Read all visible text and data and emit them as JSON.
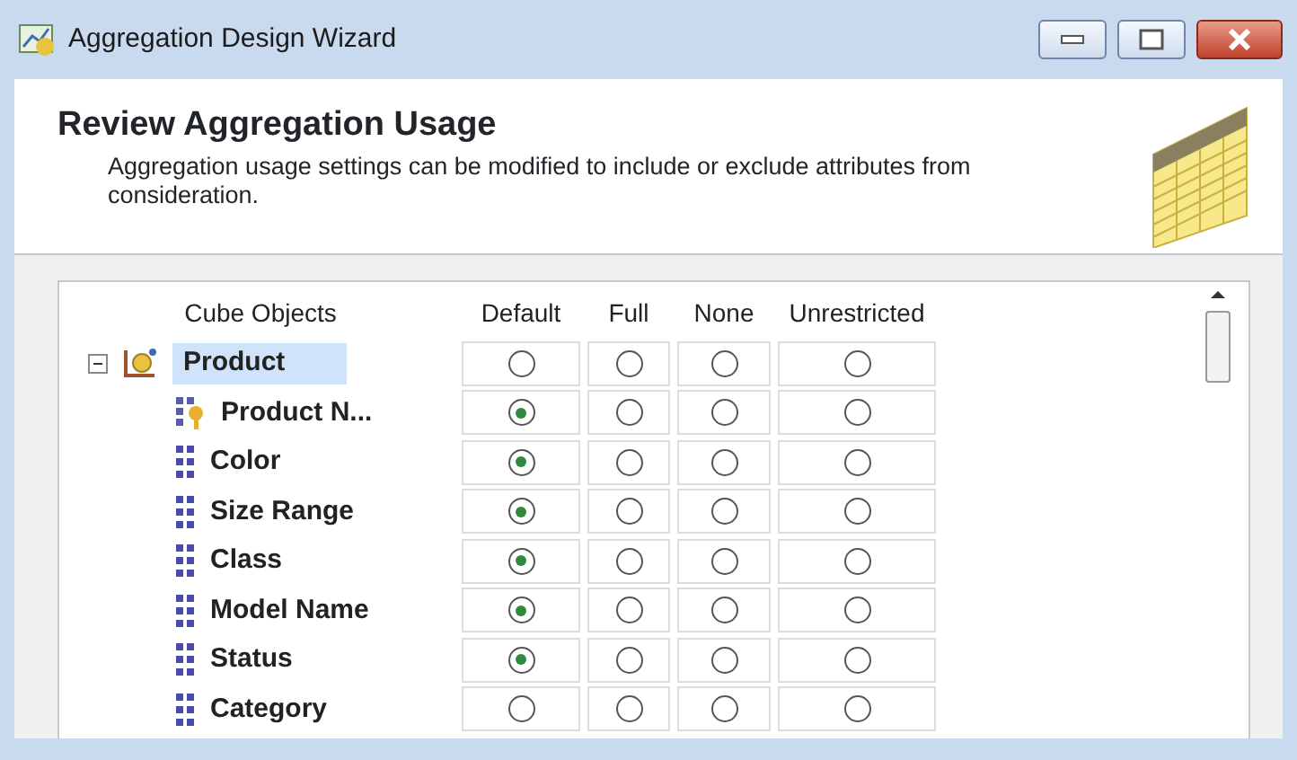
{
  "window": {
    "title": "Aggregation Design Wizard"
  },
  "header": {
    "title": "Review Aggregation Usage",
    "description": "Aggregation usage settings can be modified to include or exclude attributes from consideration."
  },
  "grid": {
    "columns": [
      "Cube Objects",
      "Default",
      "Full",
      "None",
      "Unrestricted"
    ],
    "dimension": {
      "name": "Product",
      "expanded": true,
      "selected": true,
      "options": [
        {
          "selected": false
        },
        {
          "selected": false
        },
        {
          "selected": false
        },
        {
          "selected": false
        }
      ]
    },
    "attributes": [
      {
        "name": "Product N...",
        "kind": "key",
        "options": [
          {
            "selected": true
          },
          {
            "selected": false
          },
          {
            "selected": false
          },
          {
            "selected": false
          }
        ]
      },
      {
        "name": "Color",
        "kind": "attribute",
        "options": [
          {
            "selected": true
          },
          {
            "selected": false
          },
          {
            "selected": false
          },
          {
            "selected": false
          }
        ]
      },
      {
        "name": "Size Range",
        "kind": "attribute",
        "options": [
          {
            "selected": true
          },
          {
            "selected": false
          },
          {
            "selected": false
          },
          {
            "selected": false
          }
        ]
      },
      {
        "name": "Class",
        "kind": "attribute",
        "options": [
          {
            "selected": true
          },
          {
            "selected": false
          },
          {
            "selected": false
          },
          {
            "selected": false
          }
        ]
      },
      {
        "name": "Model Name",
        "kind": "attribute",
        "options": [
          {
            "selected": true
          },
          {
            "selected": false
          },
          {
            "selected": false
          },
          {
            "selected": false
          }
        ]
      },
      {
        "name": "Status",
        "kind": "attribute",
        "options": [
          {
            "selected": true
          },
          {
            "selected": false
          },
          {
            "selected": false
          },
          {
            "selected": false
          }
        ]
      },
      {
        "name": "Category",
        "kind": "attribute",
        "options": [
          {
            "selected": false
          },
          {
            "selected": false
          },
          {
            "selected": false
          },
          {
            "selected": false
          }
        ]
      }
    ]
  }
}
